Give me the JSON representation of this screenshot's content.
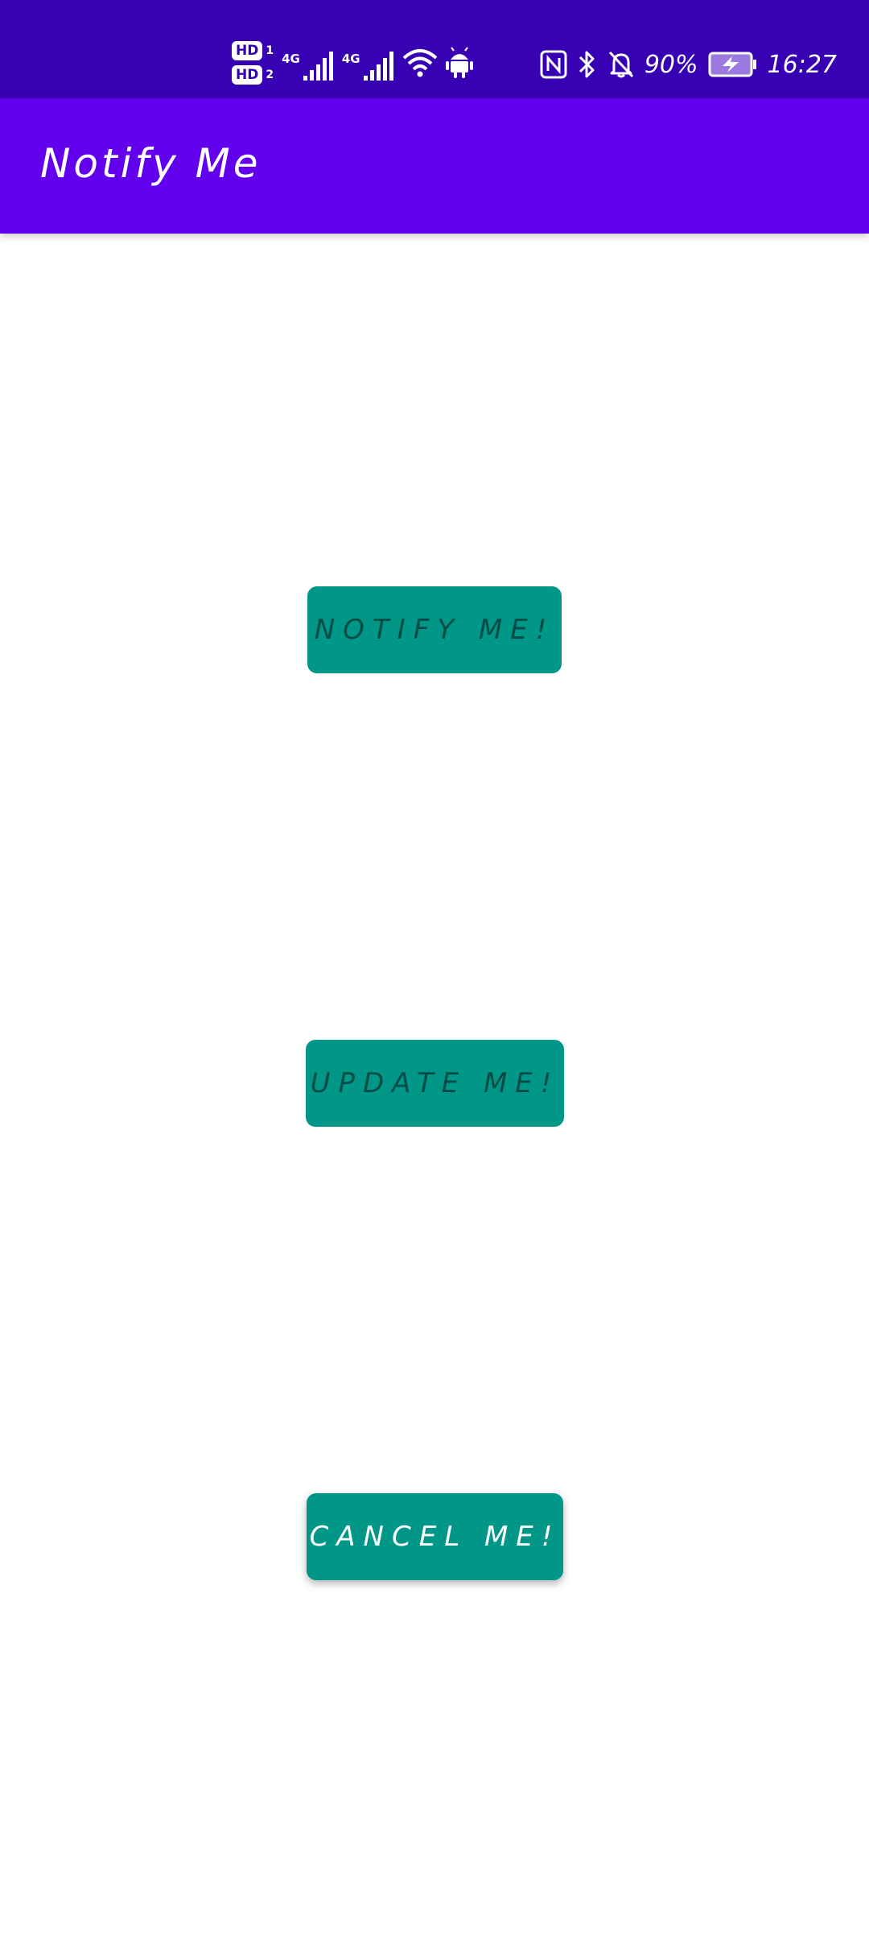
{
  "status_bar": {
    "sim1_badge": "HD",
    "sim1_index": "1",
    "sim2_badge": "HD",
    "sim2_index": "2",
    "net1_type": "4G",
    "net2_type": "4G",
    "battery_percent": "90%",
    "time": "16:27",
    "icons": [
      "hd-icon",
      "signal-icon",
      "wifi-icon",
      "android-icon",
      "nfc-icon",
      "bluetooth-icon",
      "bell-off-icon",
      "battery-charging-icon"
    ]
  },
  "app_bar": {
    "title": "Notify Me"
  },
  "buttons": {
    "notify": "NOTIFY ME!",
    "update": "UPDATE ME!",
    "cancel": "CANCEL ME!"
  },
  "colors": {
    "status_bar": "#3700b3",
    "app_bar": "#6200ee",
    "button": "#009688",
    "button_text_disabled": "#004d46",
    "button_text_enabled": "#ffffff"
  }
}
